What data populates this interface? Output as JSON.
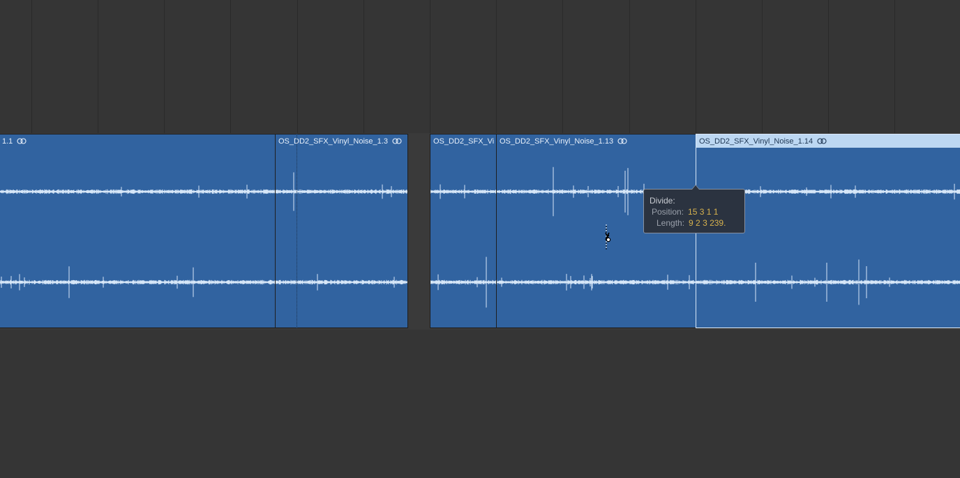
{
  "regions": [
    {
      "name": "1.1"
    },
    {
      "name": "OS_DD2_SFX_Vinyl_Noise_1.3"
    },
    {
      "name": "OS_DD2_SFX_Vi"
    },
    {
      "name": "OS_DD2_SFX_Vinyl_Noise_1.13"
    },
    {
      "name": "OS_DD2_SFX_Vinyl_Noise_1.14"
    }
  ],
  "tooltip": {
    "title": "Divide:",
    "position_label": "Position:",
    "position_value": "15 3 1 1",
    "length_label": "Length:",
    "length_value": "9 2 3 239."
  },
  "icons": {
    "loop": "loop-icon",
    "cursor": "scissors-cursor-icon"
  },
  "colors": {
    "region": "#3163a0",
    "region_selected_header": "#bcd7f2",
    "waveform": "#d6e6f7",
    "tooltip_value": "#d7b24e"
  }
}
